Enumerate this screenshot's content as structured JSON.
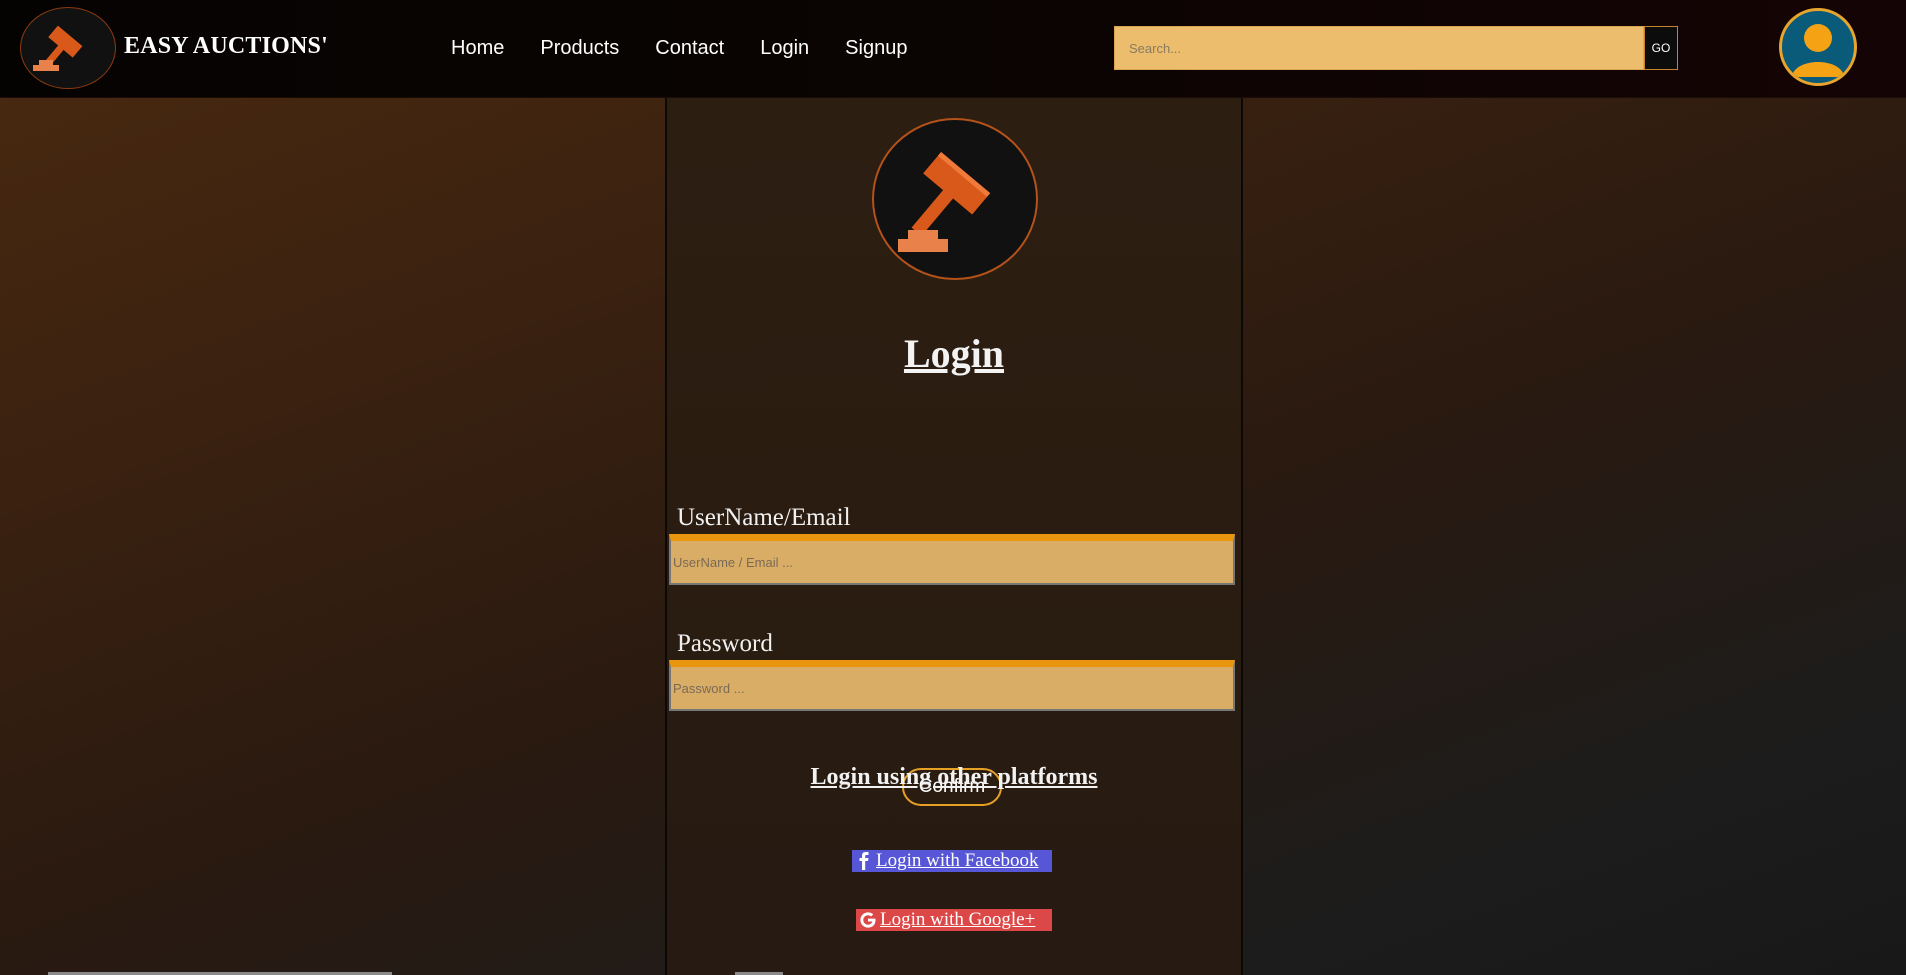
{
  "header": {
    "brand_name": "EASY AUCTIONS'",
    "nav": {
      "home": "Home",
      "products": "Products",
      "contact": "Contact",
      "login": "Login",
      "signup": "Signup"
    },
    "search": {
      "placeholder": "Search...",
      "go_label": "GO"
    },
    "avatar_icon": "user-avatar-icon"
  },
  "login_panel": {
    "logo_icon": "gavel-icon",
    "title": "Login",
    "username": {
      "label": "UserName/Email",
      "placeholder": "UserName / Email ..."
    },
    "password": {
      "label": "Password",
      "placeholder": "Password ..."
    },
    "confirm_label": "Confirm",
    "other_platforms_title": "Login using other platforms",
    "facebook_label": " Login with Facebook",
    "google_label": " Login with Google+"
  },
  "colors": {
    "accent_orange": "#e9960e",
    "input_bg": "#d9ad66",
    "search_bg": "#ebbd6c",
    "facebook": "#5656d6",
    "google": "#dc4848",
    "avatar_bg": "#0a5a7a"
  }
}
